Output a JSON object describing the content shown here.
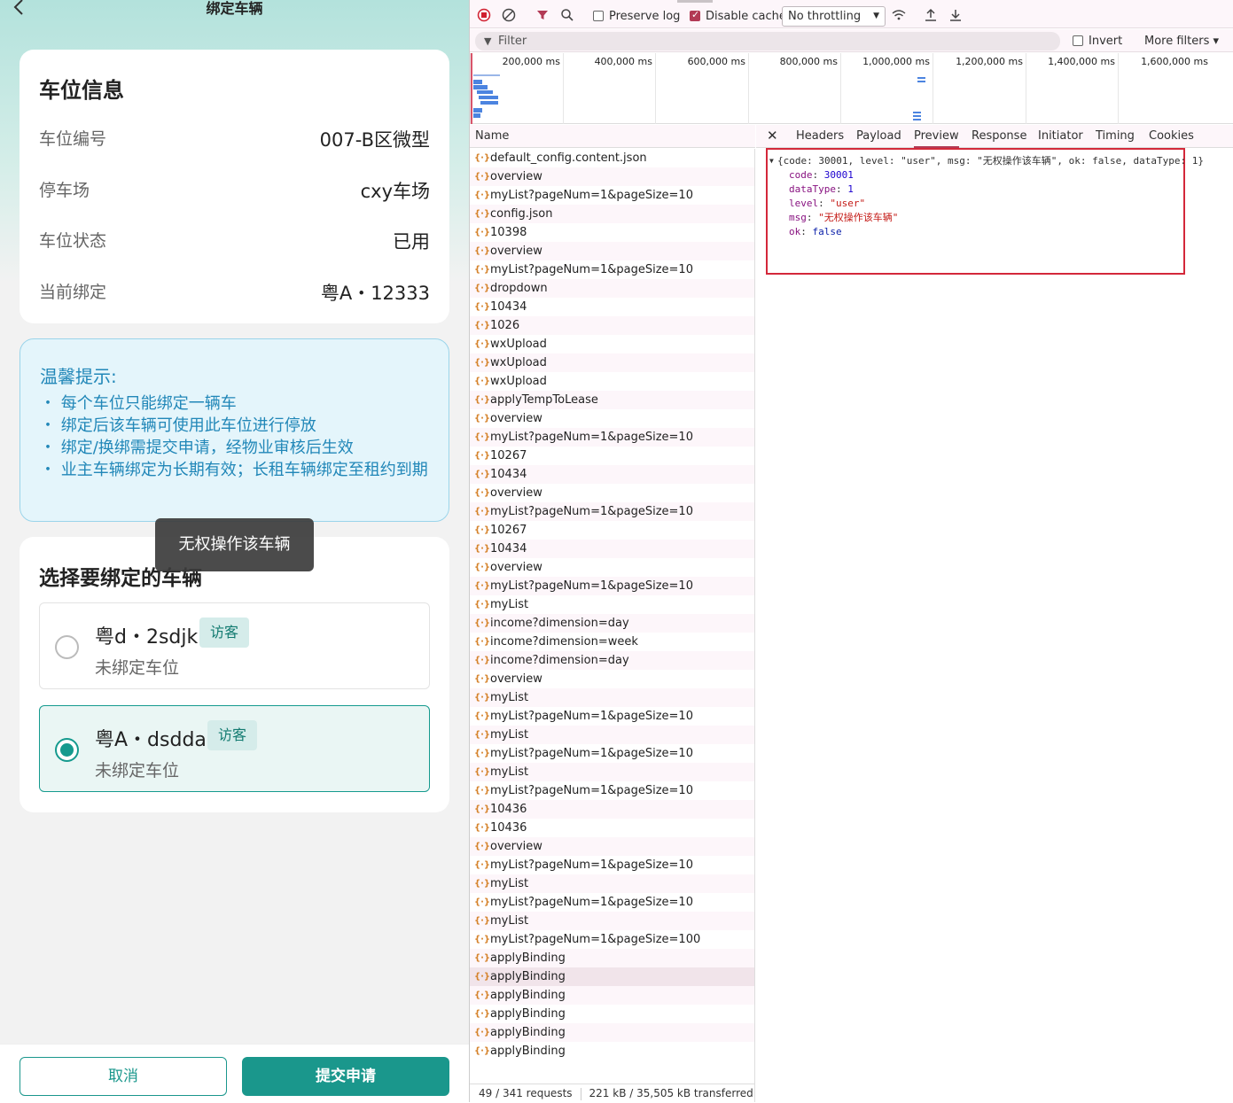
{
  "app": {
    "title": "绑定车辆",
    "back_icon": "chevron-left-icon",
    "space_card": {
      "title": "车位信息",
      "rows": [
        {
          "label": "车位编号",
          "value": "007-B区微型"
        },
        {
          "label": "停车场",
          "value": "cxy车场"
        },
        {
          "label": "车位状态",
          "value": "已用"
        },
        {
          "label": "当前绑定",
          "value": "粤A・12333"
        }
      ]
    },
    "tips": {
      "title": "温馨提示:",
      "items": [
        "・ 每个车位只能绑定一辆车",
        "・ 绑定后该车辆可使用此车位进行停放",
        "・ 绑定/换绑需提交申请，经物业审核后生效",
        "・ 业主车辆绑定为长期有效；长租车辆绑定至租约到期"
      ]
    },
    "select_card": {
      "title": "选择要绑定的车辆",
      "vehicles": [
        {
          "plate": "粤d・2sdjk",
          "badge": "访客",
          "status": "未绑定车位",
          "selected": false
        },
        {
          "plate": "粤A・dsdda",
          "badge": "访客",
          "status": "未绑定车位",
          "selected": true
        }
      ]
    },
    "toast": "无权操作该车辆",
    "cancel_label": "取消",
    "submit_label": "提交申请",
    "accent_color": "#1a978c"
  },
  "devtools": {
    "toolbar": {
      "preserve_log": "Preserve log",
      "disable_cache": "Disable cache",
      "throttling": "No throttling",
      "filter_placeholder": "Filter",
      "invert": "Invert",
      "more_filters": "More filters"
    },
    "overview_ticks": [
      "200,000 ms",
      "400,000 ms",
      "600,000 ms",
      "800,000 ms",
      "1,000,000 ms",
      "1,200,000 ms",
      "1,400,000 ms",
      "1,600,000 ms"
    ],
    "name_header": "Name",
    "requests": [
      "default_config.content.json",
      "overview",
      "myList?pageNum=1&pageSize=10",
      "config.json",
      "10398",
      "overview",
      "myList?pageNum=1&pageSize=10",
      "dropdown",
      "10434",
      "1026",
      "wxUpload",
      "wxUpload",
      "wxUpload",
      "applyTempToLease",
      "overview",
      "myList?pageNum=1&pageSize=10",
      "10267",
      "10434",
      "overview",
      "myList?pageNum=1&pageSize=10",
      "10267",
      "10434",
      "overview",
      "myList?pageNum=1&pageSize=10",
      "myList",
      "income?dimension=day",
      "income?dimension=week",
      "income?dimension=day",
      "overview",
      "myList",
      "myList?pageNum=1&pageSize=10",
      "myList",
      "myList?pageNum=1&pageSize=10",
      "myList",
      "myList?pageNum=1&pageSize=10",
      "10436",
      "10436",
      "overview",
      "myList?pageNum=1&pageSize=10",
      "myList",
      "myList?pageNum=1&pageSize=10",
      "myList",
      "myList?pageNum=1&pageSize=100",
      "applyBinding",
      "applyBinding",
      "applyBinding",
      "applyBinding",
      "applyBinding",
      "applyBinding"
    ],
    "highlighted_index": 44,
    "status": {
      "requests": "49 / 341 requests",
      "transferred": "221 kB / 35,505 kB transferred"
    },
    "tabs": [
      "Headers",
      "Payload",
      "Preview",
      "Response",
      "Initiator",
      "Timing",
      "Cookies"
    ],
    "active_tab": "Preview",
    "preview": {
      "summary": "{code: 30001, level: \"user\", msg: \"无权操作该车辆\", ok: false, dataType: 1}",
      "fields": [
        {
          "key": "code",
          "value": "30001",
          "type": "num"
        },
        {
          "key": "dataType",
          "value": "1",
          "type": "num"
        },
        {
          "key": "level",
          "value": "\"user\"",
          "type": "str"
        },
        {
          "key": "msg",
          "value": "\"无权操作该车辆\"",
          "type": "str"
        },
        {
          "key": "ok",
          "value": "false",
          "type": "kw"
        }
      ]
    }
  }
}
